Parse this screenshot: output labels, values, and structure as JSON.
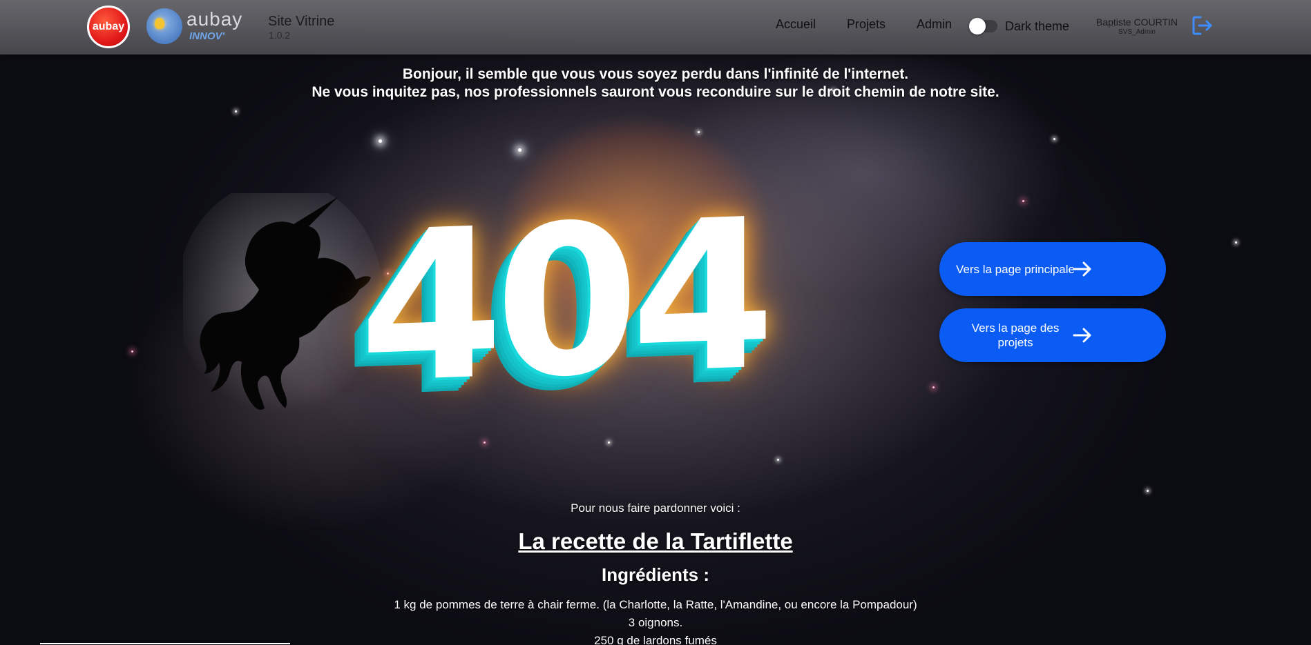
{
  "header": {
    "logo_text": "aubay",
    "innov_logo_word": "aubay",
    "innov_logo_sub": "INNOV'",
    "app_title": "Site Vitrine",
    "app_version": "1.0.2",
    "nav": [
      {
        "label": "Accueil"
      },
      {
        "label": "Projets"
      },
      {
        "label": "Admin"
      }
    ],
    "dark_theme_label": "Dark theme",
    "dark_theme_enabled": false,
    "user_name": "Baptiste COURTIN",
    "user_role": "SVS_Admin",
    "logout_icon": "logout-icon"
  },
  "intro": {
    "line1": "Bonjour, il semble que vous vous soyez perdu dans l'infinité de l'internet.",
    "line2": "Ne vous inquitez pas, nos professionnels sauront vous reconduire sur le droit chemin de notre site."
  },
  "error_code": "404",
  "buttons": [
    {
      "label": "Vers la page principale",
      "icon": "arrow-right-icon"
    },
    {
      "label": "Vers la page des projets",
      "icon": "arrow-right-icon"
    }
  ],
  "recipe": {
    "pardon_text": "Pour nous faire pardonner voici :",
    "title": "La recette de la Tartiflette",
    "ingredients_heading": "Ingrédients :",
    "ingredients": [
      "1 kg de pommes de terre à chair ferme. (la Charlotte, la Ratte, l'Amandine, ou encore la Pompadour)",
      "3 oignons.",
      "250 g de lardons fumés"
    ]
  },
  "colors": {
    "button_bg": "#0a5cf5",
    "header_bg": "#6e6e73",
    "accent_cyan": "#19d8dc",
    "glow_orange": "#ff8a1e"
  }
}
